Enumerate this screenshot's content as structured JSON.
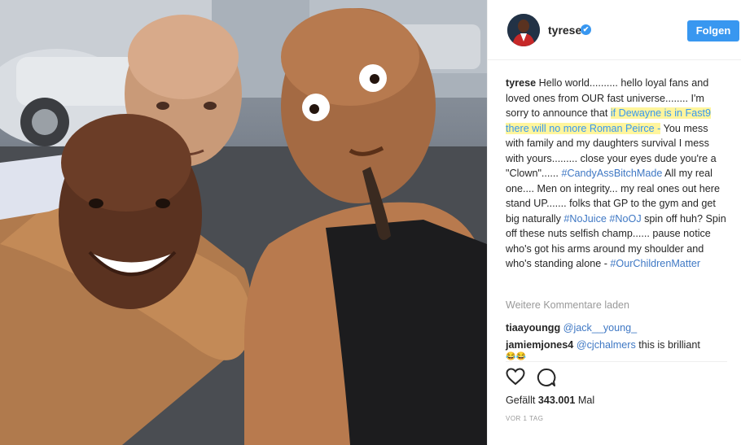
{
  "post": {
    "photo_description_icon": "photo-icon"
  },
  "header": {
    "username": "tyrese",
    "verified_icon": "✔",
    "follow_label": "Folgen"
  },
  "caption": {
    "author": "tyrese",
    "part1": "Hello world.......... hello loyal fans and loved ones from OUR fast universe........ I'm sorry to announce that ",
    "highlight": "if Dewayne is in Fast9 there will no more Roman Peirce -",
    "part2": " You mess with family and my daughters survival I mess with yours......... close your eyes dude you're a \"Clown\"...... ",
    "tag1": "#CandyAssBitchMade",
    "part3": " All my real one.... Men on integrity... my real ones out here stand UP....... folks that GP to the gym and get big naturally ",
    "tag2": "#NoJuice",
    "tag3": "#NoOJ",
    "part4": " spin off huh? Spin off these nuts selfish champ...... pause notice who's got his arms around my shoulder and who's standing alone - ",
    "tag4": "#OurChildrenMatter"
  },
  "comments": {
    "more_label": "Weitere Kommentare laden",
    "items": [
      {
        "user": "tiaayoungg",
        "mention": "@jack__young_",
        "text": ""
      },
      {
        "user": "jamiemjones4",
        "mention": "@cjchalmers",
        "text": " this is brilliant"
      }
    ],
    "emoji_line": "😂😂"
  },
  "actions": {
    "like_icon": "heart-icon",
    "comment_icon": "comment-icon",
    "likes_prefix": "Gefällt ",
    "likes_count": "343.001",
    "likes_suffix": " Mal",
    "time": "VOR 1 TAG"
  },
  "colors": {
    "accent": "#3897f0",
    "highlight": "#fff59d",
    "link": "#3f78c4"
  }
}
